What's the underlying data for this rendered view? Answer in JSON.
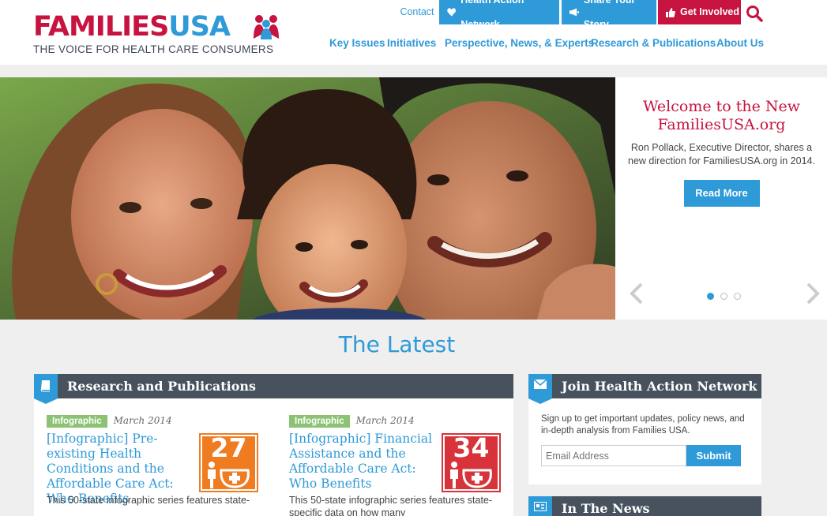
{
  "logo": {
    "families": "FAMILIES",
    "usa": "USA",
    "tagline": "THE VOICE FOR HEALTH CARE CONSUMERS"
  },
  "top_links": {
    "contact": "Contact",
    "health_action": "Health Action Network",
    "share_story": "Share Your Story",
    "get_involved": "Get Involved"
  },
  "nav": {
    "items": [
      "Key Issues",
      "Initiatives",
      "Perspective, News, & Experts",
      "Research & Publications",
      "About Us"
    ]
  },
  "hero": {
    "title": "Welcome to the New FamiliesUSA.org",
    "description": "Ron Pollack, Executive Director, shares a new direction for FamiliesUSA.org in 2014.",
    "button": "Read More",
    "slide_count": 3,
    "active_slide": 1
  },
  "latest": {
    "title": "The Latest"
  },
  "research": {
    "header": "Research and Publications",
    "articles": [
      {
        "tag": "Infographic",
        "date": "March 2014",
        "title": "[Infographic] Pre-existing Health Conditions and the Affordable Care Act: Who Benefits",
        "desc": "This 50-state infographic series features state-",
        "thumb_number": "27",
        "thumb_color": "#f07c22"
      },
      {
        "tag": "Infographic",
        "date": "March 2014",
        "title": "[Infographic] Financial Assistance and the Affordable Care Act: Who Benefits",
        "desc": "This 50-state infographic series features state-specific data on how many",
        "thumb_number": "34",
        "thumb_color": "#d8323a"
      }
    ]
  },
  "join": {
    "header": "Join Health Action Network",
    "description": "Sign up to get important updates, policy news, and in-depth analysis from Families USA.",
    "email_placeholder": "Email Address",
    "submit": "Submit"
  },
  "news": {
    "header": "In The News"
  },
  "colors": {
    "brand_red": "#c7133f",
    "brand_blue": "#2e9ad8",
    "dark_header": "#47525e",
    "tag_green": "#8cc273"
  }
}
